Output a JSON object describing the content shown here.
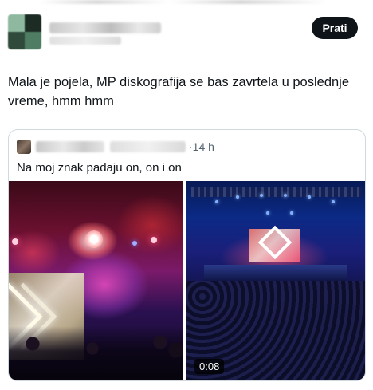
{
  "header": {
    "follow_label": "Prati"
  },
  "tweet": {
    "text": "Mala je pojela, MP diskografija se bas zavrtela u poslednje vreme, hmm hmm"
  },
  "quote": {
    "time": "14 h",
    "time_separator": "·",
    "text": "Na moj znak padaju on, on i on"
  },
  "media": {
    "video_duration": "0:08"
  },
  "colors": {
    "follow_button": "#0f1419",
    "text_primary": "#0f1419",
    "text_secondary": "#536471",
    "border": "#cfd9de"
  }
}
